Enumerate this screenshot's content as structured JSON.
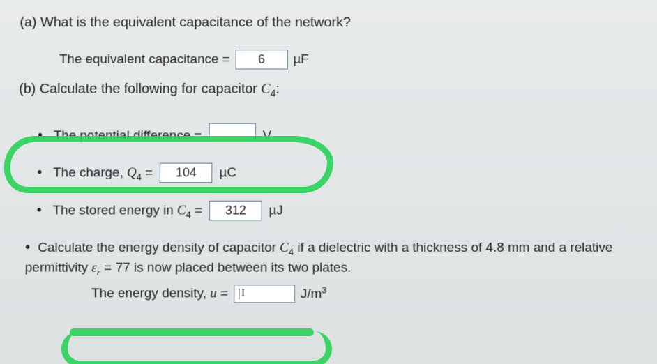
{
  "partA": {
    "label": "(a)",
    "question": "What is the equivalent capacitance of the network?",
    "answer_label": "The equivalent capacitance =",
    "answer_value": "6",
    "answer_unit": "µF"
  },
  "partB": {
    "label": "(b)",
    "question_prefix": "Calculate the following for capacitor ",
    "question_var": "C",
    "question_sub": "4",
    "question_suffix": ":",
    "items": [
      {
        "text": "The potential difference =",
        "value": "",
        "unit": "V",
        "highlighted": true
      },
      {
        "text_prefix": "The charge, ",
        "var": "Q",
        "sub": "4",
        "eq": " =",
        "value": "104",
        "unit": "µC"
      },
      {
        "text_prefix": "The stored energy in ",
        "var": "C",
        "sub": "4",
        "eq": " =",
        "value": "312",
        "unit": "µJ"
      }
    ],
    "density": {
      "para_prefix": "Calculate the energy density of capacitor ",
      "para_var": "C",
      "para_sub": "4",
      "para_mid": " if a dielectric with a thickness of ",
      "thickness": "4.8 mm",
      "para_mid2": " and a relative",
      "line2_prefix": "permittivity ",
      "eps": "ε",
      "eps_sub": "r",
      "eps_eq": " = ",
      "eps_val": "77",
      "line2_suffix": " is now placed between its two plates.",
      "answer_label": "The energy density, ",
      "answer_var": "u",
      "answer_eq": " =",
      "answer_value": "",
      "answer_unit_prefix": "J/m",
      "answer_unit_sup": "3",
      "highlighted": true
    }
  }
}
